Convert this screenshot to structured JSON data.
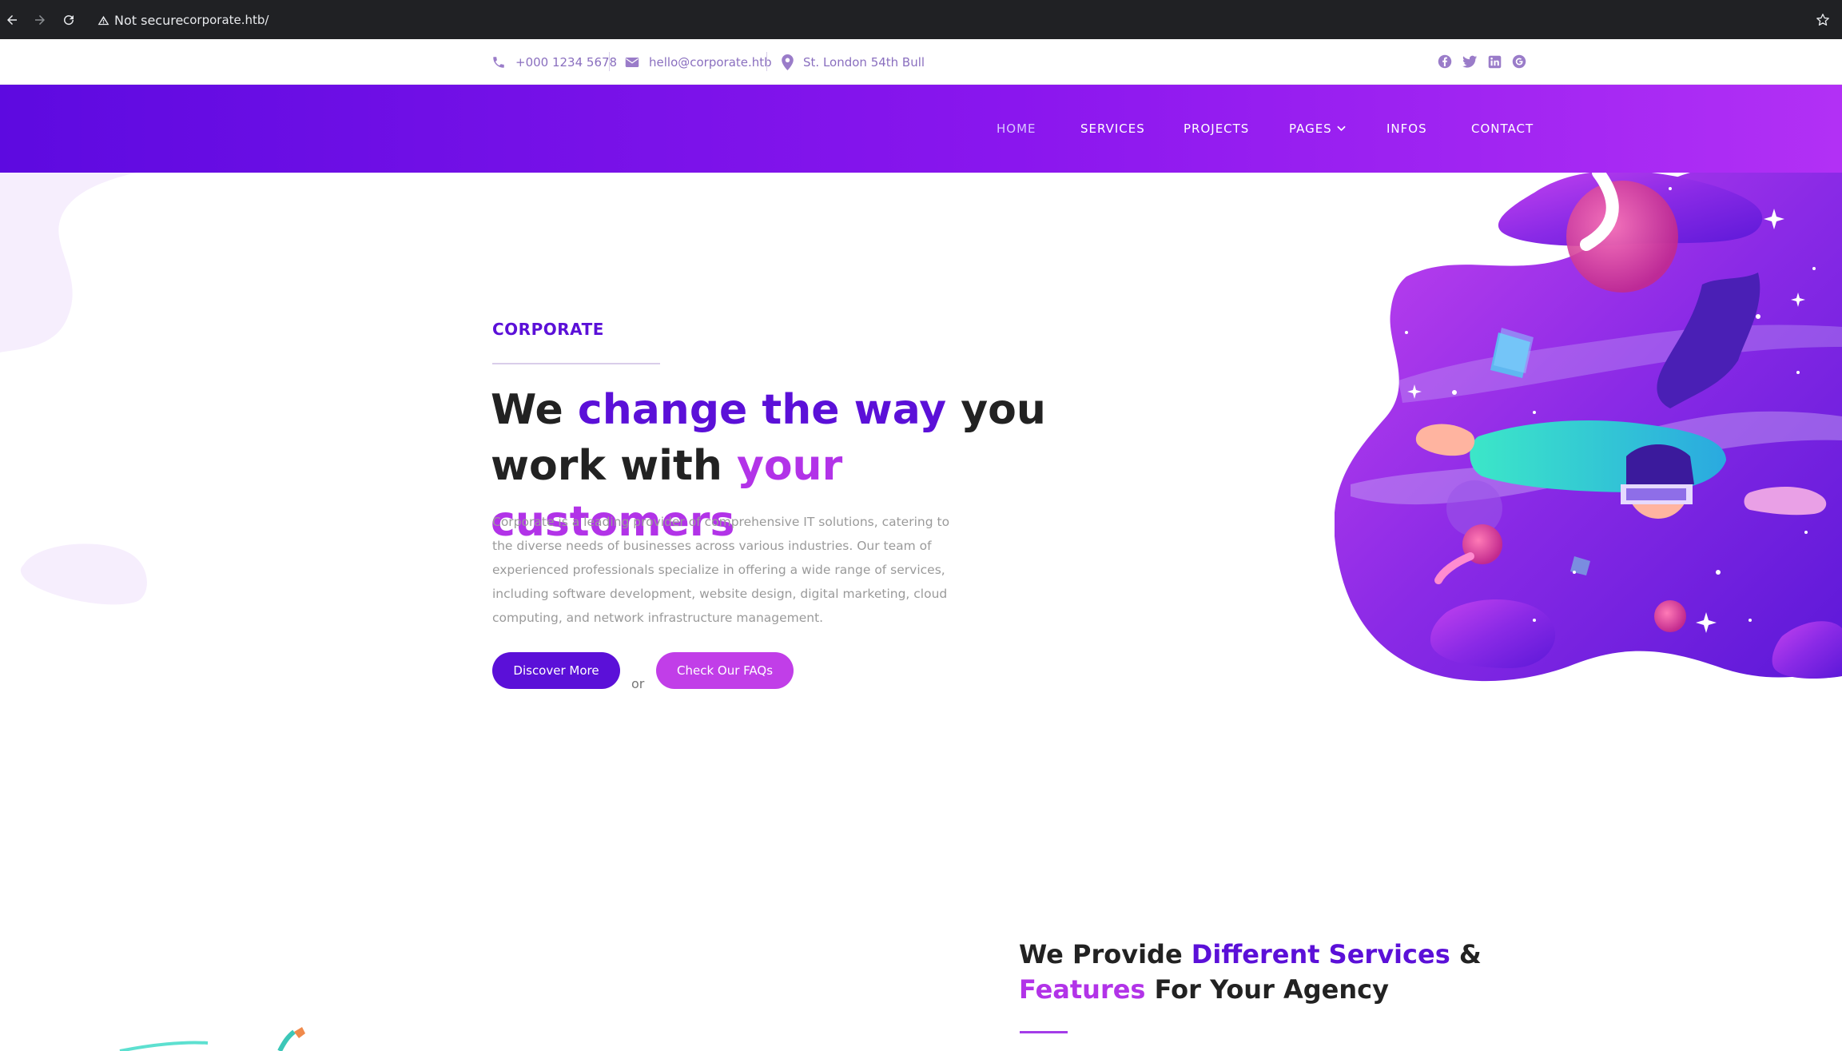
{
  "browser": {
    "security_label": "Not secure",
    "url": "corporate.htb/"
  },
  "topbar": {
    "phone": "+000 1234 5678",
    "email": "hello@corporate.htb",
    "address": "St. London 54th Bull",
    "social_icons": [
      "facebook-icon",
      "twitter-icon",
      "linkedin-icon",
      "google-icon"
    ]
  },
  "nav": {
    "items": [
      {
        "label": "HOME"
      },
      {
        "label": "SERVICES"
      },
      {
        "label": "PROJECTS"
      },
      {
        "label": "PAGES"
      },
      {
        "label": "INFOS"
      },
      {
        "label": "CONTACT"
      }
    ]
  },
  "hero": {
    "eyebrow": "CORPORATE",
    "title_part1": "We ",
    "title_highlight1": "change the way",
    "title_part2": " you work with ",
    "title_highlight2": "your customers",
    "description": "Corporate is a leading provider of comprehensive IT solutions, catering to the diverse needs of businesses across various industries. Our team of experienced professionals specialize in offering a wide range of services, including software development, website design, digital marketing, cloud computing, and network infrastructure management.",
    "primary_button": "Discover More",
    "or_text": "or",
    "secondary_button": "Check Our FAQs"
  },
  "services": {
    "title_part1": "We Provide ",
    "title_highlight1": "Different Services",
    "title_part2": " & ",
    "title_highlight2": "Features",
    "title_part3": " For Your Agency"
  },
  "colors": {
    "primary": "#5b10d8",
    "accent": "#b233e8",
    "nav_gradient_start": "#5d0ae0",
    "nav_gradient_end": "#b230f5"
  }
}
